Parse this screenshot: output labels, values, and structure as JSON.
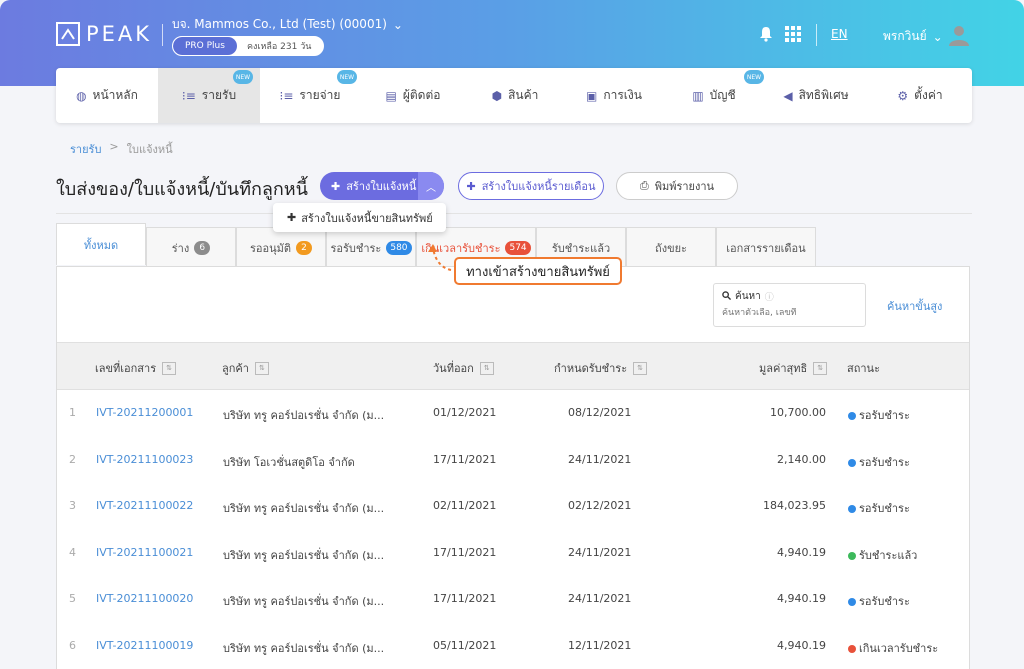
{
  "header": {
    "logo_text": "PEAK",
    "company": "บจ. Mammos Co., Ltd (Test) (00001)",
    "plan": "PRO Plus",
    "days_left": "คงเหลือ 231 วัน",
    "language": "EN",
    "user_name": "พรกวินย์"
  },
  "nav": {
    "new_label": "NEW",
    "items": [
      {
        "label": "หน้าหลัก"
      },
      {
        "label": "รายรับ"
      },
      {
        "label": "รายจ่าย"
      },
      {
        "label": "ผู้ติดต่อ"
      },
      {
        "label": "สินค้า"
      },
      {
        "label": "การเงิน"
      },
      {
        "label": "บัญชี"
      },
      {
        "label": "สิทธิพิเศษ"
      },
      {
        "label": "ตั้งค่า"
      }
    ]
  },
  "breadcrumb": {
    "root": "รายรับ",
    "sep": ">",
    "current": "ใบแจ้งหนี้"
  },
  "page": {
    "title": "ใบส่งของ/ใบแจ้งหนี้/บันทึกลูกหนี้",
    "create_button": "สร้างใบแจ้งหนี้",
    "monthly_button": "สร้างใบแจ้งหนี้รายเดือน",
    "print_button": "พิมพ์รายงาน",
    "dropdown_item": "สร้างใบแจ้งหนี้ขายสินทรัพย์"
  },
  "annotation": {
    "text": "ทางเข้าสร้างขายสินทรัพย์"
  },
  "tabs": [
    {
      "label": "ทั้งหมด",
      "count": ""
    },
    {
      "label": "ร่าง",
      "count": "6"
    },
    {
      "label": "รออนุมัติ",
      "count": "2"
    },
    {
      "label": "รอรับชำระ",
      "count": "580"
    },
    {
      "label": "เกินเวลารับชำระ",
      "count": "574"
    },
    {
      "label": "รับชำระแล้ว",
      "count": ""
    },
    {
      "label": "ถังขยะ",
      "count": ""
    },
    {
      "label": "เอกสารรายเดือน",
      "count": ""
    }
  ],
  "tab_colors": {
    "draft": "#8c8c8c",
    "pending": "#f29a1f",
    "await": "#2f8ae6",
    "overdue": "#e8513a"
  },
  "search": {
    "label": "ค้นหา",
    "placeholder": "ค้นหาตัวเลือ, เลขที่",
    "advanced": "ค้นหาขั้นสูง"
  },
  "table": {
    "columns": [
      "เลขที่เอกสาร",
      "ลูกค้า",
      "วันที่ออก",
      "กำหนดรับชำระ",
      "มูลค่าสุทธิ",
      "สถานะ"
    ],
    "rows": [
      {
        "num": "1",
        "doc": "IVT-20211200001",
        "customer": "บริษัท ทรู คอร์ปอเรชั่น จำกัด (ม...",
        "issue": "01/12/2021",
        "due": "08/12/2021",
        "amount": "10,700.00",
        "status": "รอรับชำระ",
        "color": "#2f8ae6"
      },
      {
        "num": "2",
        "doc": "IVT-20211100023",
        "customer": "บริษัท โอเวชั่นสตูดิโอ จำกัด",
        "issue": "17/11/2021",
        "due": "24/11/2021",
        "amount": "2,140.00",
        "status": "รอรับชำระ",
        "color": "#2f8ae6"
      },
      {
        "num": "3",
        "doc": "IVT-20211100022",
        "customer": "บริษัท ทรู คอร์ปอเรชั่น จำกัด (ม...",
        "issue": "02/11/2021",
        "due": "02/12/2021",
        "amount": "184,023.95",
        "status": "รอรับชำระ",
        "color": "#2f8ae6"
      },
      {
        "num": "4",
        "doc": "IVT-20211100021",
        "customer": "บริษัท ทรู คอร์ปอเรชั่น จำกัด (ม...",
        "issue": "17/11/2021",
        "due": "24/11/2021",
        "amount": "4,940.19",
        "status": "รับชำระแล้ว",
        "color": "#3cb95b"
      },
      {
        "num": "5",
        "doc": "IVT-20211100020",
        "customer": "บริษัท ทรู คอร์ปอเรชั่น จำกัด (ม...",
        "issue": "17/11/2021",
        "due": "24/11/2021",
        "amount": "4,940.19",
        "status": "รอรับชำระ",
        "color": "#2f8ae6"
      },
      {
        "num": "6",
        "doc": "IVT-20211100019",
        "customer": "บริษัท ทรู คอร์ปอเรชั่น จำกัด (ม...",
        "issue": "05/11/2021",
        "due": "12/11/2021",
        "amount": "4,940.19",
        "status": "เกินเวลารับชำระ",
        "color": "#e8513a"
      }
    ]
  }
}
